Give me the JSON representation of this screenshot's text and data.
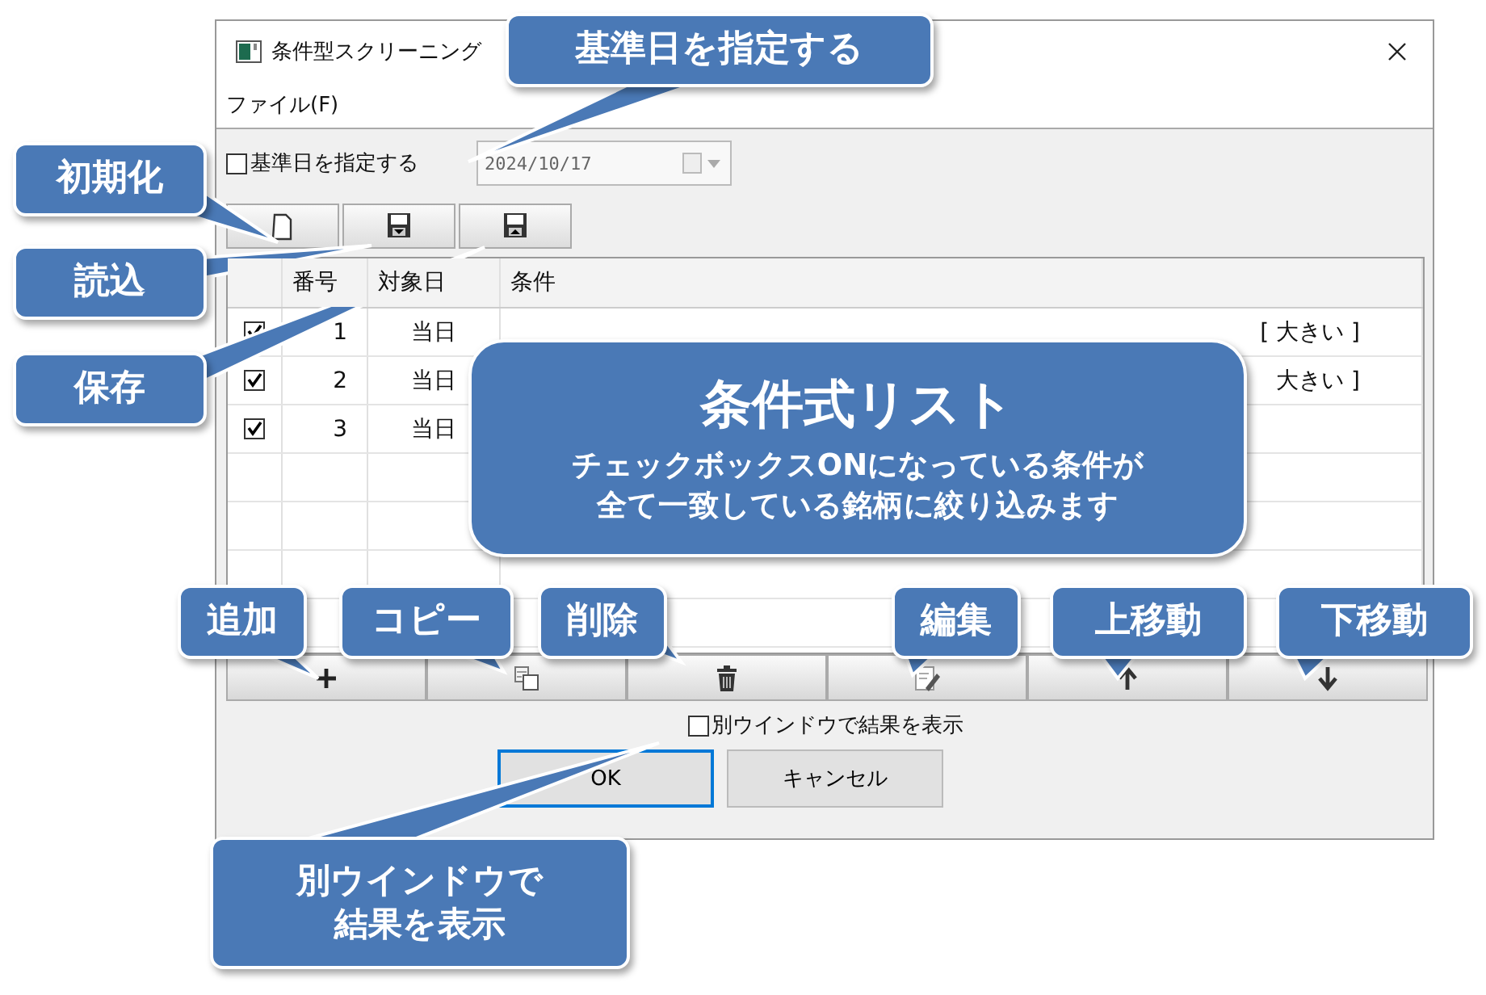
{
  "window": {
    "title": "条件型スクリーニング"
  },
  "menu": [
    "ファイル(F)"
  ],
  "base_date": {
    "label": "基準日を指定する",
    "checked": false,
    "value": "2024/10/17"
  },
  "toolbar": [
    {
      "kind": "new"
    },
    {
      "kind": "load"
    },
    {
      "kind": "save"
    }
  ],
  "table": {
    "columns": [
      "番号",
      "対象日",
      "条件"
    ],
    "rows": [
      {
        "checked": true,
        "number": "1",
        "date": "当日",
        "condition": "[ 大きい ]"
      },
      {
        "checked": true,
        "number": "2",
        "date": "当日",
        "condition": "大きい ]"
      },
      {
        "checked": true,
        "number": "3",
        "date": "当日"
      }
    ]
  },
  "row_buttons": [
    {
      "kind": "add"
    },
    {
      "kind": "copy"
    },
    {
      "kind": "delete"
    },
    {
      "kind": "edit"
    },
    {
      "kind": "up"
    },
    {
      "kind": "down"
    }
  ],
  "separate_window": {
    "label": "別ウインドウで結果を表示",
    "checked": false
  },
  "buttons": [
    {
      "label": "OK",
      "default": true
    },
    {
      "label": "キャンセル",
      "default": false
    }
  ],
  "callouts": [
    {
      "lines": [
        "基準日を指定する"
      ]
    },
    {
      "lines": [
        "初期化"
      ]
    },
    {
      "lines": [
        "読込"
      ]
    },
    {
      "lines": [
        "保存"
      ]
    },
    {
      "lines": [
        "追加"
      ]
    },
    {
      "lines": [
        "コピー"
      ]
    },
    {
      "lines": [
        "削除"
      ]
    },
    {
      "lines": [
        "編集"
      ]
    },
    {
      "lines": [
        "上移動"
      ]
    },
    {
      "lines": [
        "下移動"
      ]
    },
    {
      "lines": [
        "別ウインドウで",
        "結果を表示"
      ]
    }
  ],
  "list_callout": {
    "title": "条件式リスト",
    "lines": [
      "チェックボックスONになっている条件が",
      "全て一致している銘柄に絞り込みます"
    ]
  }
}
